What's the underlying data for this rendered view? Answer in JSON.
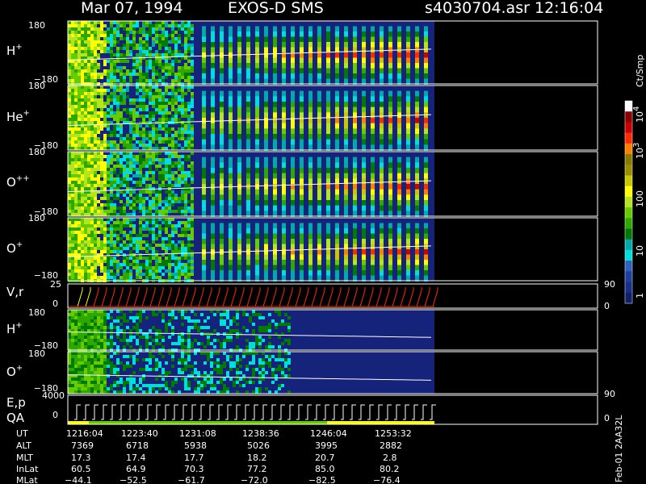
{
  "title_left": "Mar 07, 1994",
  "title_mid": "EXOS-D SMS",
  "title_file": "s4030704.asr",
  "title_time": "12:16:04",
  "colorbar": {
    "unit": "Ct/Smp",
    "labels": [
      "10",
      "4",
      "10",
      "3",
      "100",
      "10",
      "1"
    ],
    "colors": [
      "#fff",
      "#8b0000",
      "#cc0000",
      "#ff2a00",
      "#ff8000",
      "#8a7a00",
      "#9b8f00",
      "#c8c800",
      "#ffff00",
      "#b5e61d",
      "#66cc00",
      "#2ea800",
      "#007a00",
      "#00aaaa",
      "#00dddd",
      "#3060c0",
      "#1e3fa0",
      "#1a2f88",
      "#10206a"
    ]
  },
  "panels": [
    {
      "ion": "H",
      "sup": "+",
      "ytop": "180",
      "ybot": "−180"
    },
    {
      "ion": "He",
      "sup": "+",
      "ytop": "180",
      "ybot": "−180"
    },
    {
      "ion": "O",
      "sup": "++",
      "ytop": "180",
      "ybot": "−180"
    },
    {
      "ion": "O",
      "sup": "+",
      "ytop": "180",
      "ybot": "−180"
    }
  ],
  "vr_panel": {
    "label": "V,r",
    "ytop": "25",
    "ybot": "0",
    "rtop": "90",
    "rbot": "0"
  },
  "low_panels": [
    {
      "ion": "H",
      "sup": "+",
      "ytop": "180",
      "ybot": "−180"
    },
    {
      "ion": "O",
      "sup": "+",
      "ytop": "180",
      "ybot": "−180"
    }
  ],
  "ep_panel": {
    "label1": "E,p",
    "label2": "QA",
    "ytop": "4000",
    "ybot": "0",
    "rtop": "90",
    "rbot": "0"
  },
  "side_label": "Feb-01 2AA32L",
  "footer": {
    "row_labels": [
      "UT",
      "ALT",
      "MLT",
      "InLat",
      "MLat"
    ],
    "columns": [
      [
        "1216:04",
        "7369",
        "17.3",
        "60.5",
        "−44.1"
      ],
      [
        "1223:40",
        "6718",
        "17.4",
        "64.9",
        "−52.5"
      ],
      [
        "1231:08",
        "5938",
        "17.7",
        "70.3",
        "−61.7"
      ],
      [
        "1238:36",
        "5026",
        "18.2",
        "77.2",
        "−72.0"
      ],
      [
        "1246:04",
        "3995",
        "20.7",
        "85.0",
        "−82.5"
      ],
      [
        "1253:32",
        "2882",
        "2.8",
        "80.2",
        "−76.4"
      ]
    ]
  },
  "chart_data": {
    "type": "heatmap",
    "title": "Mar 07, 1994   EXOS-D SMS",
    "subtitle": "s4030704.asr  12:16:04",
    "x_ticks": [
      "1216:04",
      "1223:40",
      "1231:08",
      "1238:36",
      "1246:04",
      "1253:32"
    ],
    "panels": [
      "H+",
      "He+",
      "O++",
      "O+",
      "V,r",
      "H+",
      "O+",
      "E,p QA"
    ],
    "pitch_angle_range": [
      -180,
      180
    ],
    "vr_range": [
      0,
      25
    ],
    "ep_range": [
      0,
      4000
    ],
    "colorbar_range": [
      1,
      10000
    ],
    "colorbar_scale": "log",
    "colorbar_ticks": [
      "1",
      "10",
      "100",
      "10^3",
      "10^4"
    ]
  }
}
